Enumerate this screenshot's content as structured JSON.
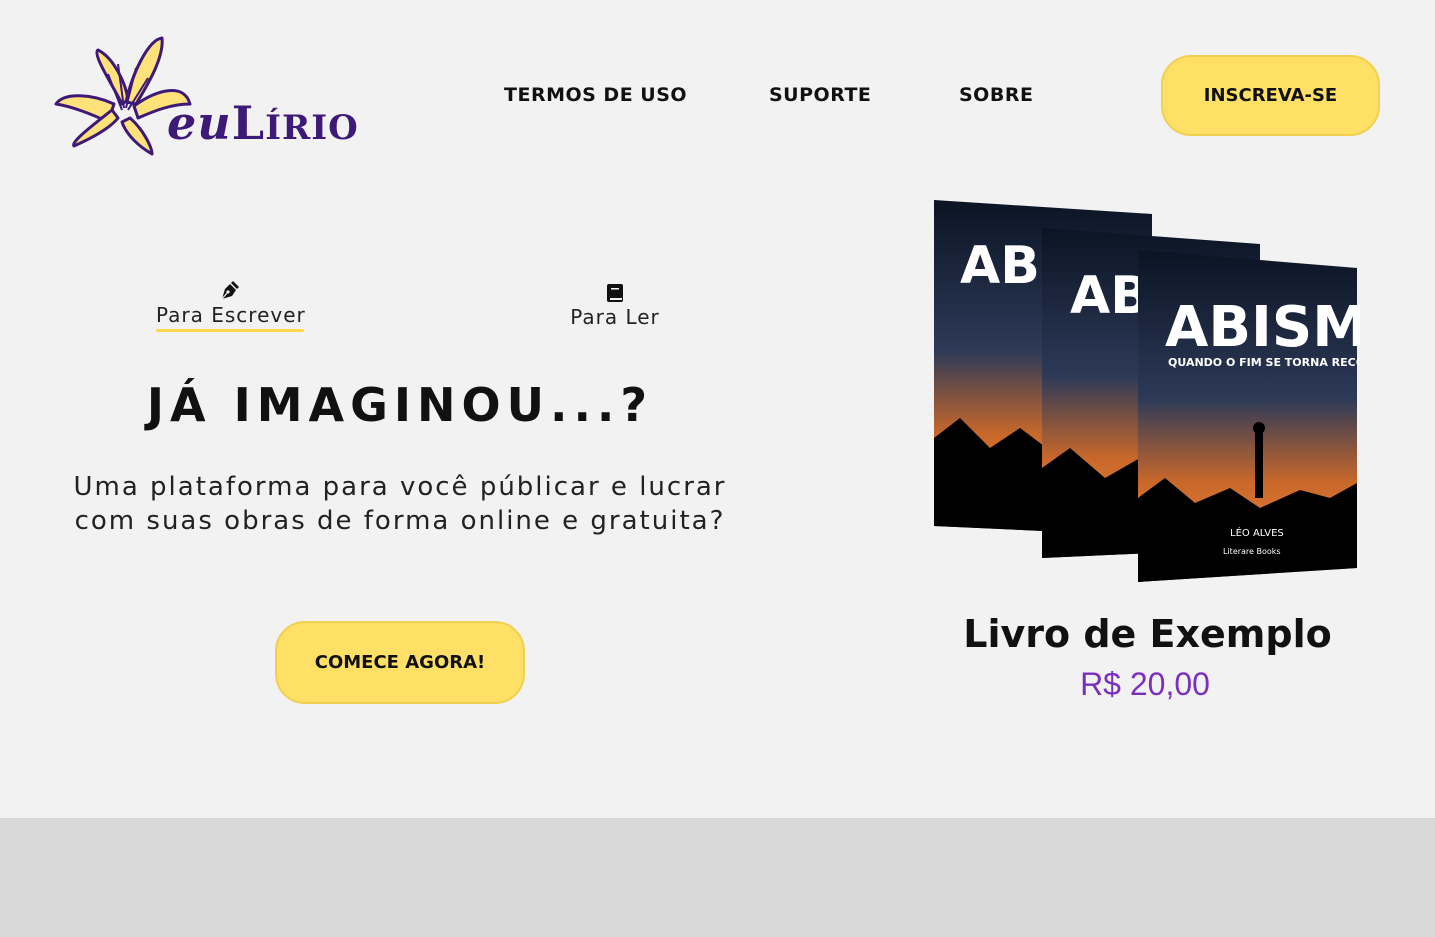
{
  "brand": {
    "logo_prefix": "eu",
    "logo_initial": "L",
    "logo_rest": "ÍRIO"
  },
  "nav": {
    "items": [
      "TERMOS DE USO",
      "SUPORTE",
      "SOBRE"
    ],
    "subscribe_label": "INSCREVA-SE"
  },
  "tabs": [
    {
      "label": "Para Escrever",
      "icon": "pen-nib-icon",
      "active": true
    },
    {
      "label": "Para Ler",
      "icon": "book-icon",
      "active": false
    }
  ],
  "hero": {
    "headline": "JÁ IMAGINOU...?",
    "subtitle_line1": "Uma plataforma para você públicar e lucrar",
    "subtitle_line2": "com suas obras de forma online e gratuita?",
    "cta_label": "COMECE AGORA!"
  },
  "featured_book": {
    "cover_title": "ABISMO",
    "cover_subtitle": "QUANDO O FIM SE TORNA RECOMEÇO",
    "cover_author": "LÉO ALVES",
    "cover_publisher": "Literare Books",
    "name": "Livro de Exemplo",
    "price": "R$ 20,00"
  },
  "colors": {
    "accent_yellow": "#ffe066",
    "brand_purple": "#3d1a78",
    "price_purple": "#7b2fbf",
    "background": "#f2f2f2",
    "footer_band": "#d9d9d9"
  }
}
